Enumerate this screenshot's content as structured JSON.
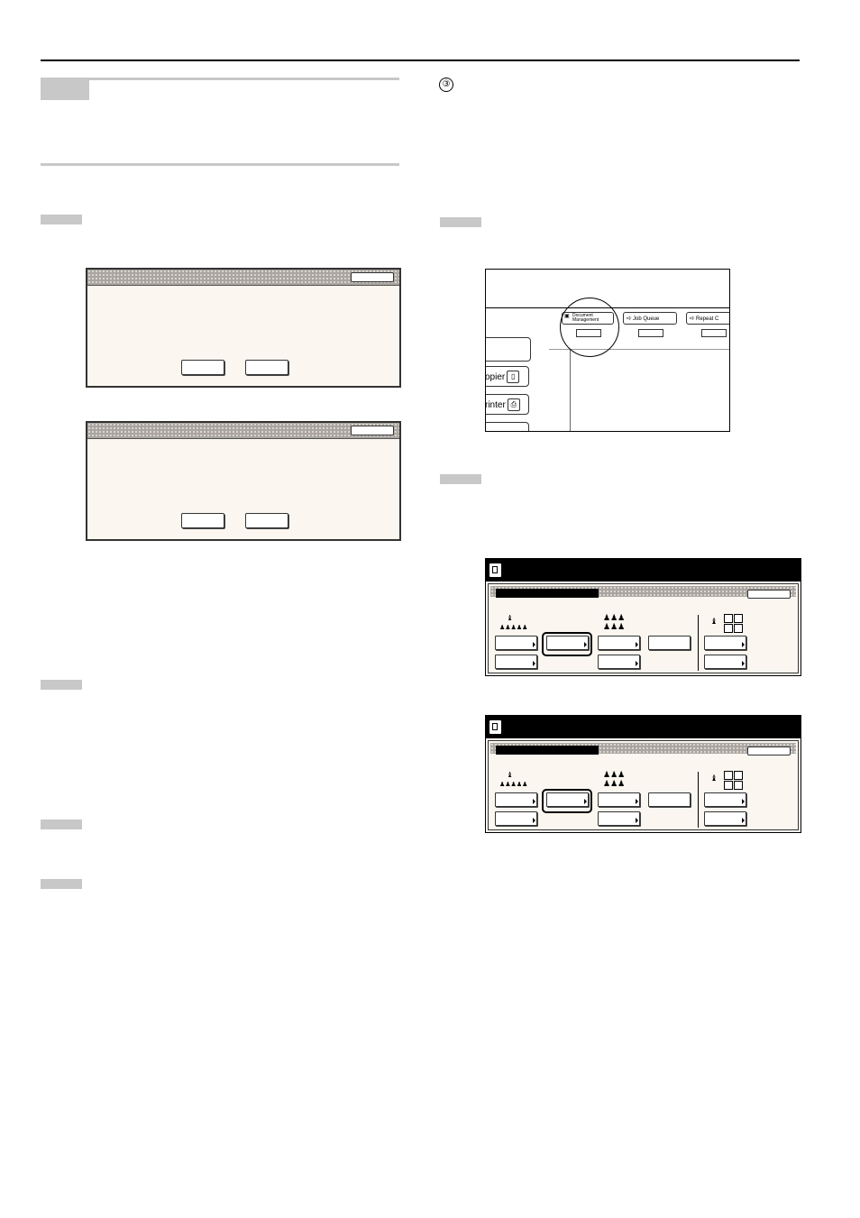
{
  "step_marker": "③",
  "panel_illustration": {
    "key_document_management": "Document\nManagement",
    "key_job_queue": "Job Queue",
    "key_repeat_copy": "Repeat C",
    "mode_copier": "opier",
    "mode_printer": "rinter"
  }
}
